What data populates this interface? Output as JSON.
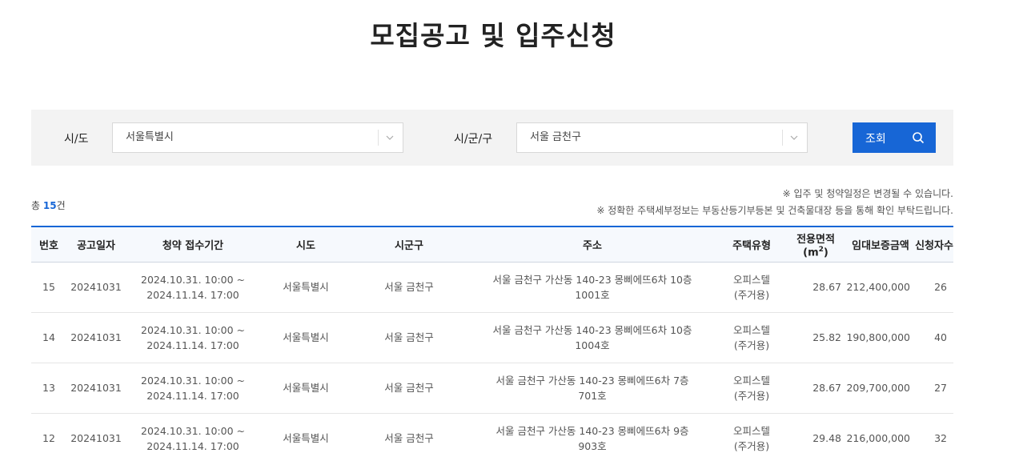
{
  "page": {
    "title": "모집공고 및 입주신청"
  },
  "search": {
    "sido_label": "시/도",
    "sido_value": "서울특별시",
    "sigungu_label": "시/군/구",
    "sigungu_value": "서울 금천구",
    "button_label": "조회",
    "button_icon": "search-icon",
    "select_icon": "chevron-down-icon"
  },
  "summary": {
    "total_prefix": "총 ",
    "total_count": "15",
    "total_suffix": "건",
    "notice_1": "※ 입주 및 청약일정은 변경될 수 있습니다.",
    "notice_2": "※ 정확한 주택세부정보는 부동산등기부등본 및 건축물대장 등을 통해 확인 부탁드립니다."
  },
  "table": {
    "headers": [
      "번호",
      "공고일자",
      "청약 접수기간",
      "시도",
      "시군구",
      "주소",
      "주택유형",
      "전용면적(m",
      "임대보증금액",
      "신청자수"
    ],
    "area_sup": "2",
    "area_close": ")",
    "rows": [
      {
        "no": "15",
        "date": "20241031",
        "period_1": "2024.10.31. 10:00 ~",
        "period_2": "2024.11.14. 17:00",
        "sido": "서울특별시",
        "sigungu": "서울 금천구",
        "addr_1": "서울 금천구 가산동 140-23 몽삐에뜨6차 10층",
        "addr_2": "1001호",
        "type_1": "오피스텔",
        "type_2": "(주거용)",
        "area": "28.67",
        "deposit": "212,400,000",
        "applicants": "26"
      },
      {
        "no": "14",
        "date": "20241031",
        "period_1": "2024.10.31. 10:00 ~",
        "period_2": "2024.11.14. 17:00",
        "sido": "서울특별시",
        "sigungu": "서울 금천구",
        "addr_1": "서울 금천구 가산동 140-23 몽삐에뜨6차 10층",
        "addr_2": "1004호",
        "type_1": "오피스텔",
        "type_2": "(주거용)",
        "area": "25.82",
        "deposit": "190,800,000",
        "applicants": "40"
      },
      {
        "no": "13",
        "date": "20241031",
        "period_1": "2024.10.31. 10:00 ~",
        "period_2": "2024.11.14. 17:00",
        "sido": "서울특별시",
        "sigungu": "서울 금천구",
        "addr_1": "서울 금천구 가산동 140-23 몽삐에뜨6차 7층",
        "addr_2": "701호",
        "type_1": "오피스텔",
        "type_2": "(주거용)",
        "area": "28.67",
        "deposit": "209,700,000",
        "applicants": "27"
      },
      {
        "no": "12",
        "date": "20241031",
        "period_1": "2024.10.31. 10:00 ~",
        "period_2": "2024.11.14. 17:00",
        "sido": "서울특별시",
        "sigungu": "서울 금천구",
        "addr_1": "서울 금천구 가산동 140-23 몽삐에뜨6차 9층",
        "addr_2": "903호",
        "type_1": "오피스텔",
        "type_2": "(주거용)",
        "area": "29.48",
        "deposit": "216,000,000",
        "applicants": "32"
      }
    ]
  },
  "colors": {
    "accent": "#1766d6",
    "panel_bg": "#f3f3f3",
    "header_bg": "#f6f9fd"
  }
}
